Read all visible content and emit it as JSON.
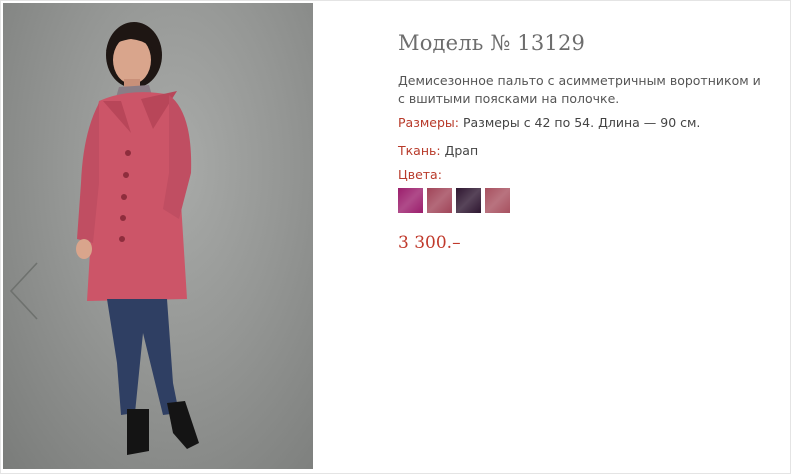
{
  "product": {
    "title": "Модель № 13129",
    "description": "Демисезонное пальто с асимметричным воротником и с вшитыми поясками на полочке.",
    "sizes_label": "Размеры:",
    "sizes_value": "Размеры с 42 по 54. Длина — 90 см.",
    "fabric_label": "Ткань:",
    "fabric_value": "Драп",
    "colors_label": "Цвета:",
    "price": "3 300.–"
  },
  "swatches": [
    "#9b1e6c",
    "#a04458",
    "#2e1630",
    "#a7505f"
  ],
  "icons": {
    "prev": "chevron-left-icon"
  },
  "colors": {
    "accent": "#b83a2a",
    "price": "#c0392b"
  }
}
